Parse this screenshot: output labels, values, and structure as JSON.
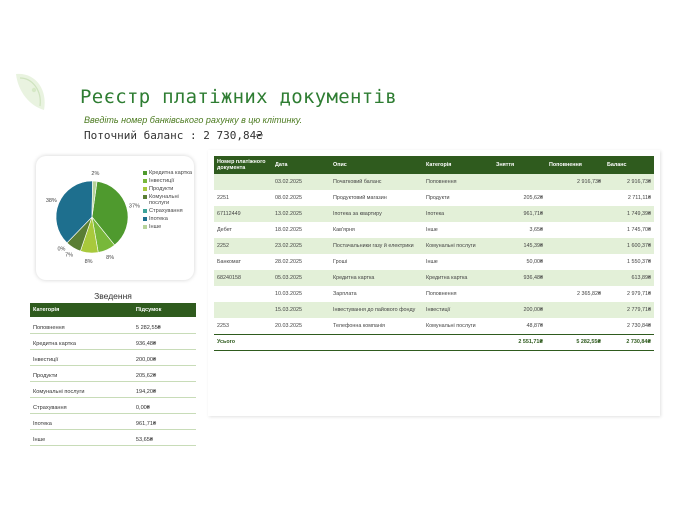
{
  "header": {
    "title": "Реєстр платіжних документів",
    "hint": "Введіть номер банківського рахунку в цю клітинку.",
    "balance": "Поточний баланс : 2 730,84₴"
  },
  "chart_data": {
    "type": "pie",
    "slices": [
      {
        "name": "Кредитна картка",
        "percent": 37,
        "label": "37%",
        "color": "#4f9a2e"
      },
      {
        "name": "Інвестиції",
        "percent": 8,
        "label": "8%",
        "color": "#78b83a"
      },
      {
        "name": "Продукти",
        "percent": 8,
        "label": "8%",
        "color": "#a8c93c"
      },
      {
        "name": "Комунальні послуги",
        "percent": 7,
        "label": "7%",
        "color": "#5a7e34"
      },
      {
        "name": "Страхування",
        "percent": 0,
        "label": "0%",
        "color": "#3da39a"
      },
      {
        "name": "Іпотека",
        "percent": 38,
        "label": "38%",
        "color": "#1e6f8e"
      },
      {
        "name": "Інше",
        "percent": 2,
        "label": "2%",
        "color": "#b7d39a"
      }
    ],
    "legend_position": "right"
  },
  "summary": {
    "title": "Зведення",
    "headers": [
      "Категорія",
      "Підсумок"
    ],
    "rows": [
      [
        "Поповнення",
        "5 282,55₴"
      ],
      [
        "Кредитна картка",
        "936,48₴"
      ],
      [
        "Інвестиції",
        "200,00₴"
      ],
      [
        "Продукти",
        "205,62₴"
      ],
      [
        "Комунальні послуги",
        "194,20₴"
      ],
      [
        "Страхування",
        "0,00₴"
      ],
      [
        "Іпотека",
        "961,71₴"
      ],
      [
        "Інше",
        "53,65₴"
      ]
    ]
  },
  "register": {
    "headers": [
      "Номер платіжного документа",
      "Дата",
      "Опис",
      "Категорія",
      "Зняття",
      "Поповнення",
      "Баланс"
    ],
    "rows": [
      [
        "",
        "03.02.2025",
        "Початковий баланс",
        "Поповнення",
        "",
        "2 916,73₴",
        "2 916,73₴"
      ],
      [
        "2251",
        "08.02.2025",
        "Продуктовий магазин",
        "Продукти",
        "205,62₴",
        "",
        "2 711,11₴"
      ],
      [
        "67112449",
        "13.02.2025",
        "Іпотека за квартиру",
        "Іпотека",
        "961,71₴",
        "",
        "1 749,39₴"
      ],
      [
        "Дебет",
        "18.02.2025",
        "Кав'ярня",
        "Інше",
        "3,65₴",
        "",
        "1 745,70₴"
      ],
      [
        "2252",
        "23.02.2025",
        "Постачальники газу й електрики",
        "Комунальні послуги",
        "145,39₴",
        "",
        "1 600,37₴"
      ],
      [
        "Банкомат",
        "28.02.2025",
        "Гроші",
        "Інше",
        "50,00₴",
        "",
        "1 550,37₴"
      ],
      [
        "68240158",
        "05.03.2025",
        "Кредитна картка",
        "Кредитна картка",
        "936,48₴",
        "",
        "613,89₴"
      ],
      [
        "",
        "10.03.2025",
        "Зарплата",
        "Поповнення",
        "",
        "2 365,82₴",
        "2 979,71₴"
      ],
      [
        "",
        "15.03.2025",
        "Інвестування до пайового фонду",
        "Інвестиції",
        "200,00₴",
        "",
        "2 779,71₴"
      ],
      [
        "2253",
        "20.03.2025",
        "Телефонна компанія",
        "Комунальні послуги",
        "48,87₴",
        "",
        "2 730,84₴"
      ]
    ],
    "total": [
      "Усього",
      "",
      "",
      "",
      "2 551,71₴",
      "5 282,55₴",
      "2 730,84₴"
    ]
  }
}
